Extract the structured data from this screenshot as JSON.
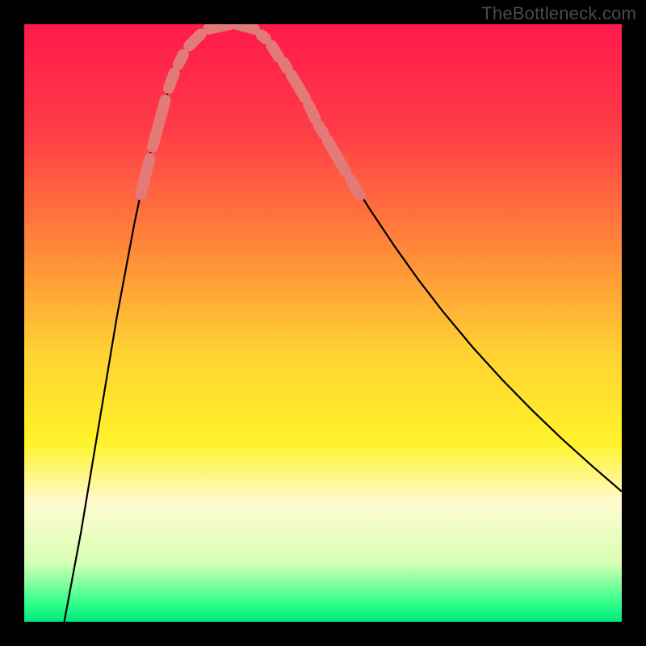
{
  "watermark": "TheBottleneck.com",
  "chart_data": {
    "type": "line",
    "title": "",
    "xlabel": "",
    "ylabel": "",
    "xlim": [
      0,
      100
    ],
    "ylim": [
      100,
      0
    ],
    "background_gradient": {
      "stops": [
        {
          "offset": 0,
          "color": "#ff1a4b"
        },
        {
          "offset": 18,
          "color": "#ff3c47"
        },
        {
          "offset": 38,
          "color": "#ff8a38"
        },
        {
          "offset": 55,
          "color": "#ffd233"
        },
        {
          "offset": 70,
          "color": "#fff22a"
        },
        {
          "offset": 80,
          "color": "#fffbcf"
        },
        {
          "offset": 90,
          "color": "#d8ffb5"
        },
        {
          "offset": 97,
          "color": "#2fff8b"
        },
        {
          "offset": 100,
          "color": "#00e67a"
        }
      ]
    },
    "series": [
      {
        "name": "curve",
        "stroke": "#000000",
        "points": [
          {
            "x": 6.7,
            "y": 0.0
          },
          {
            "x": 8.0,
            "y": 7.0
          },
          {
            "x": 9.5,
            "y": 15.0
          },
          {
            "x": 11.0,
            "y": 24.0
          },
          {
            "x": 12.5,
            "y": 33.0
          },
          {
            "x": 14.0,
            "y": 42.0
          },
          {
            "x": 15.5,
            "y": 51.0
          },
          {
            "x": 17.0,
            "y": 59.0
          },
          {
            "x": 18.5,
            "y": 67.0
          },
          {
            "x": 20.0,
            "y": 74.0
          },
          {
            "x": 21.5,
            "y": 80.0
          },
          {
            "x": 23.0,
            "y": 85.5
          },
          {
            "x": 24.5,
            "y": 90.0
          },
          {
            "x": 26.0,
            "y": 93.5
          },
          {
            "x": 27.5,
            "y": 96.0
          },
          {
            "x": 29.0,
            "y": 97.8
          },
          {
            "x": 30.5,
            "y": 99.0
          },
          {
            "x": 32.0,
            "y": 99.6
          },
          {
            "x": 33.5,
            "y": 99.9
          },
          {
            "x": 35.0,
            "y": 100.0
          },
          {
            "x": 36.5,
            "y": 99.8
          },
          {
            "x": 38.0,
            "y": 99.3
          },
          {
            "x": 39.5,
            "y": 98.3
          },
          {
            "x": 41.0,
            "y": 96.8
          },
          {
            "x": 43.0,
            "y": 94.2
          },
          {
            "x": 45.0,
            "y": 91.0
          },
          {
            "x": 47.0,
            "y": 87.5
          },
          {
            "x": 49.0,
            "y": 83.8
          },
          {
            "x": 52.0,
            "y": 78.5
          },
          {
            "x": 55.0,
            "y": 73.5
          },
          {
            "x": 58.0,
            "y": 68.8
          },
          {
            "x": 62.0,
            "y": 62.8
          },
          {
            "x": 66.0,
            "y": 57.2
          },
          {
            "x": 70.0,
            "y": 52.0
          },
          {
            "x": 75.0,
            "y": 46.0
          },
          {
            "x": 80.0,
            "y": 40.5
          },
          {
            "x": 85.0,
            "y": 35.4
          },
          {
            "x": 90.0,
            "y": 30.6
          },
          {
            "x": 95.0,
            "y": 26.1
          },
          {
            "x": 100.0,
            "y": 21.8
          }
        ]
      },
      {
        "name": "left-capsules",
        "stroke": "#e27a78",
        "cap": "round",
        "width": 14,
        "segments": [
          {
            "x1": 19.5,
            "y1": 71.5,
            "x2": 21.0,
            "y2": 77.5
          },
          {
            "x1": 21.5,
            "y1": 79.5,
            "x2": 23.6,
            "y2": 87.3
          },
          {
            "x1": 24.2,
            "y1": 89.3,
            "x2": 25.1,
            "y2": 91.8
          },
          {
            "x1": 25.8,
            "y1": 93.3,
            "x2": 26.6,
            "y2": 94.9
          },
          {
            "x1": 27.6,
            "y1": 96.4,
            "x2": 29.5,
            "y2": 98.3
          }
        ]
      },
      {
        "name": "bottom-capsules",
        "stroke": "#e27a78",
        "cap": "round",
        "width": 14,
        "segments": [
          {
            "x1": 30.8,
            "y1": 99.2,
            "x2": 34.5,
            "y2": 100.0
          },
          {
            "x1": 35.6,
            "y1": 100.0,
            "x2": 38.5,
            "y2": 99.2
          },
          {
            "x1": 39.7,
            "y1": 98.2,
            "x2": 40.4,
            "y2": 97.6
          }
        ]
      },
      {
        "name": "right-capsules",
        "stroke": "#e27a78",
        "cap": "round",
        "width": 14,
        "segments": [
          {
            "x1": 41.4,
            "y1": 96.4,
            "x2": 42.6,
            "y2": 94.5
          },
          {
            "x1": 43.4,
            "y1": 93.6,
            "x2": 44.0,
            "y2": 92.6
          },
          {
            "x1": 44.7,
            "y1": 91.5,
            "x2": 47.0,
            "y2": 87.7
          },
          {
            "x1": 47.6,
            "y1": 86.5,
            "x2": 48.7,
            "y2": 84.2
          },
          {
            "x1": 49.3,
            "y1": 83.0,
            "x2": 50.1,
            "y2": 81.7
          },
          {
            "x1": 50.8,
            "y1": 80.5,
            "x2": 53.8,
            "y2": 75.3
          },
          {
            "x1": 54.6,
            "y1": 74.0,
            "x2": 56.2,
            "y2": 71.4
          }
        ]
      }
    ]
  }
}
